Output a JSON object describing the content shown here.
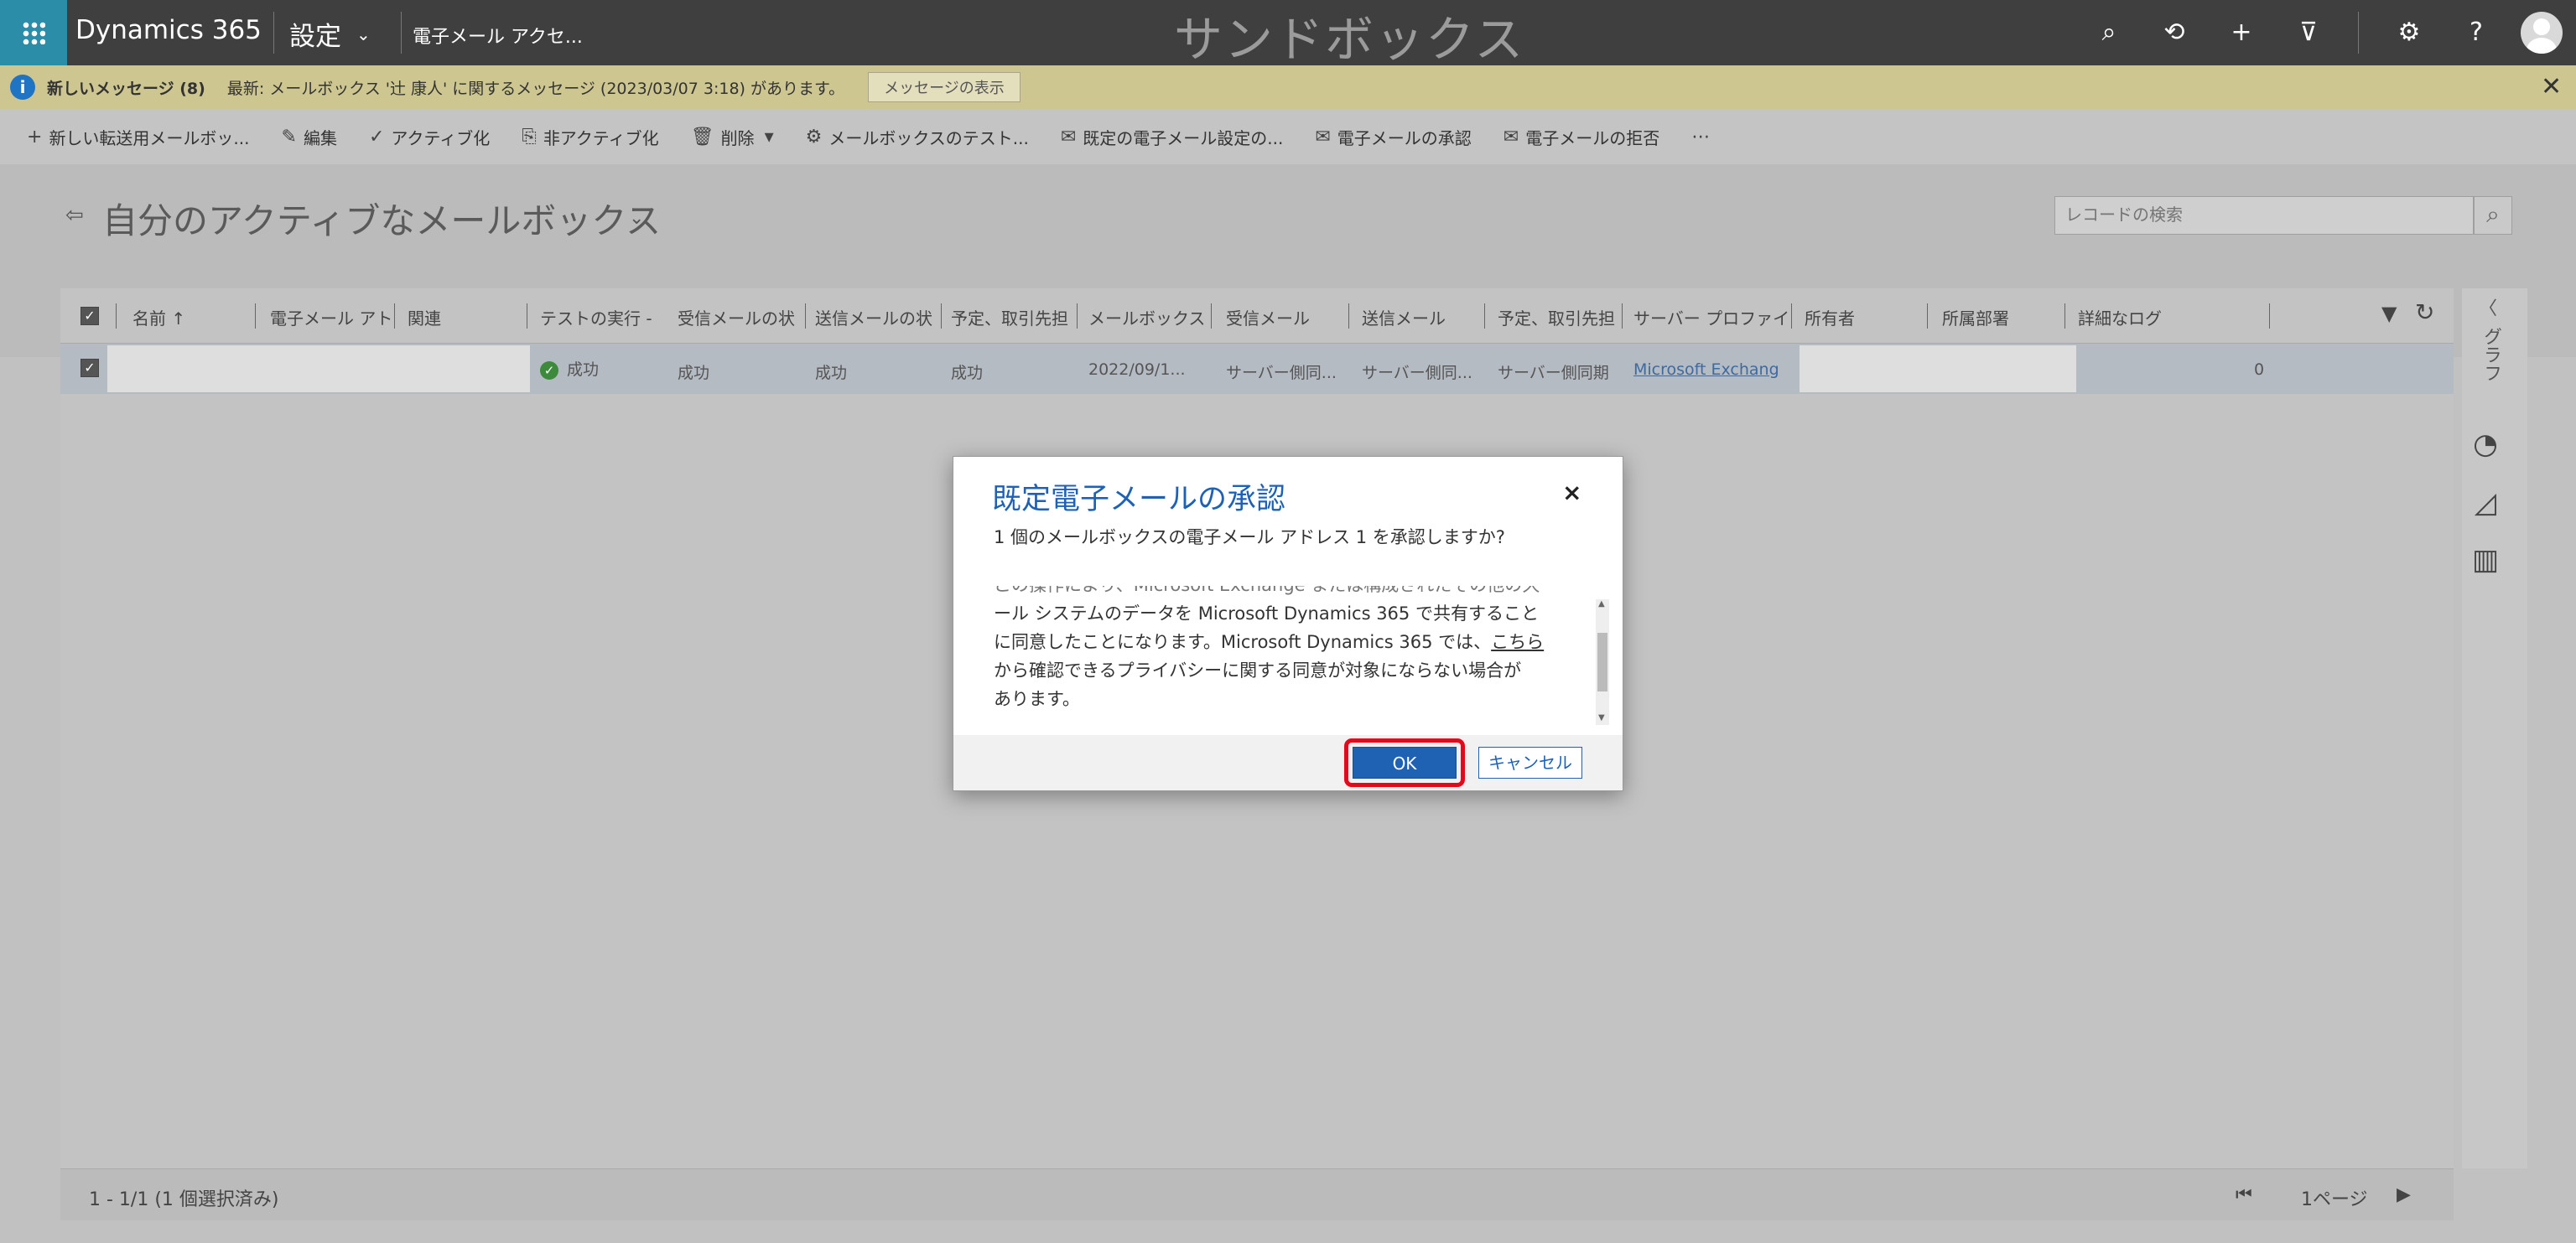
{
  "topbar": {
    "brand": "Dynamics 365",
    "area": "設定",
    "area_chevron": "⌄",
    "breadcrumb": "電子メール アクセ...",
    "environment": "サンドボックス",
    "icons": [
      "search-icon",
      "history-icon",
      "plus-icon",
      "filter-icon",
      "gear-icon",
      "help-icon",
      "avatar"
    ],
    "search_glyph": "⌕",
    "history_glyph": "⟲",
    "plus_glyph": "+",
    "filter_glyph": "⊽",
    "gear_glyph": "⚙",
    "help_glyph": "?"
  },
  "notification": {
    "icon": "i",
    "title": "新しいメッセージ (8)",
    "text": "最新: メールボックス '辻 康人' に関するメッセージ (2023/03/07 3:18) があります。",
    "button": "メッセージの表示",
    "close": "✕"
  },
  "commands": [
    {
      "icon": "+",
      "label": "新しい転送用メールボッ..."
    },
    {
      "icon": "✎",
      "label": "編集"
    },
    {
      "icon": "✓",
      "label": "アクティブ化"
    },
    {
      "icon": "⎘",
      "label": "非アクティブ化"
    },
    {
      "icon": "🗑",
      "label": "削除"
    },
    {
      "icon": "▾",
      "label": ""
    },
    {
      "icon": "⚙",
      "label": "メールボックスのテスト..."
    },
    {
      "icon": "✉",
      "label": "既定の電子メール設定の..."
    },
    {
      "icon": "✉",
      "label": "電子メールの承認"
    },
    {
      "icon": "✉",
      "label": "電子メールの拒否"
    },
    {
      "icon": "⋯",
      "label": ""
    }
  ],
  "view": {
    "back": "⇦",
    "title": "自分のアクティブなメールボックス",
    "chevron": "⌄",
    "search_placeholder": "レコードの検索",
    "search_glyph": "⌕"
  },
  "grid": {
    "check": "✓",
    "columns": [
      "名前 ↑",
      "電子メール アト",
      "関連",
      "テストの実行 -",
      "受信メールの状",
      "送信メールの状",
      "予定、取引先担",
      "メールボックス",
      "受信メール",
      "送信メール",
      "予定、取引先担",
      "サーバー プロファイ",
      "所有者",
      "所属部署",
      "詳細なログ"
    ],
    "row": {
      "test_status": "成功",
      "incoming_status": "成功",
      "outgoing_status": "成功",
      "appointments_status": "成功",
      "mailbox_date": "2022/09/1...",
      "incoming": "サーバー側同...",
      "outgoing": "サーバー側同...",
      "appointments": "サーバー側同期",
      "server_profile": "Microsoft Exchang",
      "log_count": "0"
    },
    "footer_count": "1 - 1/1 (1 個選択済み)",
    "page_first": "⏮",
    "page_prev": "◀",
    "page_label": "1ページ",
    "page_next": "▶"
  },
  "right_panel": {
    "chevron": "〈",
    "label": "グラフ",
    "icons": [
      "pie-chart-icon",
      "area-chart-icon",
      "bar-chart-icon"
    ],
    "pie_glyph": "◔",
    "area_glyph": "◿",
    "bar_glyph": "▥",
    "filter_glyph": "▼",
    "refresh_glyph": "↻"
  },
  "dialog": {
    "title": "既定電子メールの承認",
    "close": "×",
    "question": "1 個のメールボックスの電子メール アドレス 1 を承認しますか?",
    "body_line0": "この操作により、Microsoft Exchange または構成されたその他の久",
    "body_line1": "ール システムのデータを Microsoft Dynamics 365 で共有すること",
    "body_line2a": "に同意したことになります。Microsoft Dynamics 365 では、",
    "body_link": "こちら",
    "body_line3": "から確認できるプライバシーに関する同意が対象にならない場合が",
    "body_line4": "あります。",
    "ok": "OK",
    "cancel": "キャンセル",
    "scroll_up": "▲",
    "scroll_down": "▼"
  },
  "colors": {
    "topbar": "#3f3f3f",
    "waffle": "#2c8da8",
    "notification": "#cdc691",
    "accent": "#1f62b4",
    "highlight": "#e5081a"
  }
}
